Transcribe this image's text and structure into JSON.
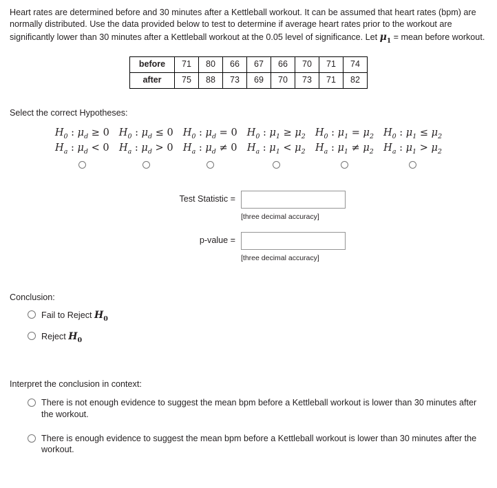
{
  "question": {
    "prompt_part1": "Heart rates are determined before and 30 minutes after a Kettleball workout. It can be assumed that heart rates (bpm) are normally distributed. Use the data provided below to test to determine if average heart rates prior to the workout are significantly lower than 30 minutes after a Kettleball workout at the 0.05 level of significance. Let ",
    "prompt_mu": "μ",
    "prompt_mu_sub": "1",
    "prompt_part2": " = mean before workout."
  },
  "data_table": {
    "row_labels": [
      "before",
      "after"
    ],
    "before": [
      "71",
      "80",
      "66",
      "67",
      "66",
      "70",
      "71",
      "74"
    ],
    "after": [
      "75",
      "88",
      "73",
      "69",
      "70",
      "73",
      "71",
      "82"
    ]
  },
  "hypotheses": {
    "instruction": "Select the correct Hypotheses:",
    "options": [
      {
        "null": "H₀ : μd ≥ 0",
        "alt": "Hₐ : μd < 0"
      },
      {
        "null": "H₀ : μd ≤ 0",
        "alt": "Hₐ : μd > 0"
      },
      {
        "null": "H₀ : μd = 0",
        "alt": "Hₐ : μd ≠ 0"
      },
      {
        "null": "H₀ : μ1 ≥ μ2",
        "alt": "Hₐ : μ1 < μ2"
      },
      {
        "null": "H₀ : μ1 = μ2",
        "alt": "Hₐ : μ1 ≠ μ2"
      },
      {
        "null": "H₀ : μ1 ≤ μ2",
        "alt": "Hₐ : μ1 > μ2"
      }
    ]
  },
  "fields": {
    "test_statistic_label": "Test Statistic =",
    "test_statistic_value": "",
    "test_statistic_hint": "[three decimal accuracy]",
    "p_value_label": "p-value =",
    "p_value_value": "",
    "p_value_hint": "[three decimal accuracy]"
  },
  "conclusion": {
    "label": "Conclusion:",
    "options": [
      {
        "prefix": "Fail to Reject ",
        "symbol": "H",
        "sub": "0"
      },
      {
        "prefix": "Reject ",
        "symbol": "H",
        "sub": "0"
      }
    ]
  },
  "interpretation": {
    "label": "Interpret the conclusion in context:",
    "options": [
      "There is not enough evidence to suggest the mean bpm before a Kettleball workout is lower than 30 minutes after the workout.",
      "There is enough evidence to suggest the mean bpm before a Kettleball workout is lower than 30 minutes after the workout."
    ]
  }
}
